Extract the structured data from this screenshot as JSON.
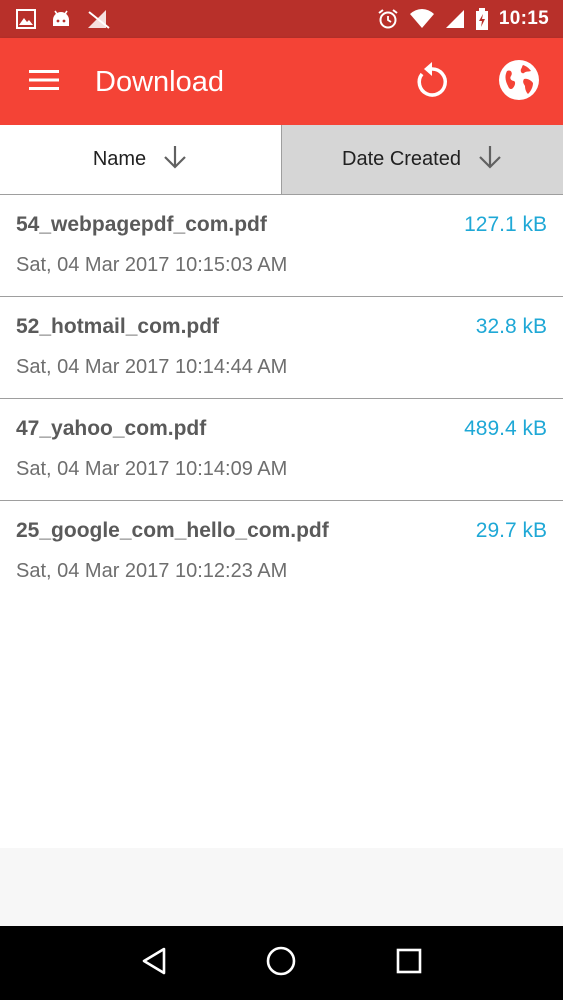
{
  "status_bar": {
    "time": "10:15",
    "icons": [
      "image-icon",
      "android-icon",
      "signal-off-icon",
      "alarm-icon",
      "wifi-icon",
      "cell-signal-icon",
      "battery-charging-icon"
    ],
    "background": "#b8302a"
  },
  "app_bar": {
    "title": "Download",
    "background": "#f44336",
    "icons": [
      "menu-icon",
      "refresh-icon",
      "globe-icon"
    ]
  },
  "sort": {
    "name_label": "Name",
    "date_label": "Date Created",
    "active": "Date Created"
  },
  "files": [
    {
      "name": "54_webpagepdf_com.pdf",
      "size": "127.1 kB",
      "date": "Sat, 04 Mar 2017 10:15:03 AM"
    },
    {
      "name": "52_hotmail_com.pdf",
      "size": "32.8 kB",
      "date": "Sat, 04 Mar 2017 10:14:44 AM"
    },
    {
      "name": "47_yahoo_com.pdf",
      "size": "489.4 kB",
      "date": "Sat, 04 Mar 2017 10:14:09 AM"
    },
    {
      "name": "25_google_com_hello_com.pdf",
      "size": "29.7 kB",
      "date": "Sat, 04 Mar 2017 10:12:23 AM"
    }
  ],
  "colors": {
    "accent": "#f44336",
    "size_text": "#1fa8d6"
  },
  "nav_bar": {
    "icons": [
      "back-icon",
      "home-icon",
      "recents-icon"
    ]
  }
}
